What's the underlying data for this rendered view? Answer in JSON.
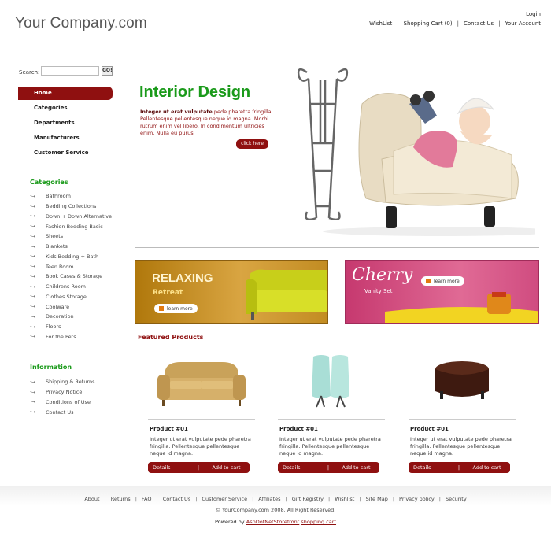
{
  "header": {
    "logo": "Your Company.com",
    "login": "Login",
    "nav": [
      "WishList",
      "Shopping Cart (0)",
      "Contact Us",
      "Your Account"
    ]
  },
  "search": {
    "label": "Search:",
    "value": "",
    "go": "GO!"
  },
  "sidebar": {
    "main_nav": [
      "Home",
      "Categories",
      "Departments",
      "Manufacturers",
      "Customer Service"
    ],
    "categories_title": "Categories",
    "categories": [
      "Bathroom",
      "Bedding Collections",
      "Down + Down Alternative",
      "Fashion Bedding Basic",
      "Sheets",
      "Blankets",
      "Kids Bedding + Bath",
      "Teen Room",
      "Book Cases & Storage",
      "Childrens Room",
      "Clothes Storage",
      "Coolware",
      "Decoration",
      "Floors",
      "For the Pets"
    ],
    "information_title": "Information",
    "information": [
      "Shipping & Returns",
      "Privacy Notice",
      "Conditions of Use",
      "Contact Us"
    ]
  },
  "hero": {
    "title": "Interior Design",
    "lead": "Integer ut erat vulputate",
    "text": " pede pharetra fringilla. Pellentesque pellentesque neque id magna. Morbi rutrum enim vel libero. In condimentum ultricies enim. Nulla eu purus.",
    "button": "click here"
  },
  "banners": [
    {
      "title": "RELAXING",
      "subtitle": "Retreat",
      "button": "learn more"
    },
    {
      "title": "Cherry",
      "subtitle": "Vanity Set",
      "button": "learn more"
    }
  ],
  "featured_title": "Featured Products",
  "products": [
    {
      "name": "Product #01",
      "desc": "Integer ut erat vulputate pede pharetra fringilla. Pellentesque pellentesque neque id magna.",
      "details": "Details",
      "sep": "|",
      "cart": "Add to cart"
    },
    {
      "name": "Product #01",
      "desc": "Integer ut erat vulputate pede pharetra fringilla. Pellentesque pellentesque neque id magna.",
      "details": "Details",
      "sep": "|",
      "cart": "Add to cart"
    },
    {
      "name": "Product #01",
      "desc": "Integer ut erat vulputate pede pharetra fringilla. Pellentesque pellentesque neque id magna.",
      "details": "Details",
      "sep": "|",
      "cart": "Add to cart"
    }
  ],
  "footer": {
    "links": [
      "About",
      "Returns",
      "FAQ",
      "Contact Us",
      "Customer Service",
      "Affiliates",
      "Gift Registry",
      "Wishlist",
      "Site Map",
      "Privacy policy",
      "Security"
    ],
    "copyright": "© YourCompany.com 2008. All Right Reserved.",
    "powered_prefix": "Powered by",
    "powered_link1": "AspDotNetStorefront",
    "powered_link2": "shopping cart"
  },
  "colors": {
    "brand_red": "#8f1010",
    "accent_green": "#1a9a1a"
  },
  "icons": {
    "list_arrow": "dotted-arrow-icon",
    "learn_more": "orange-square-icon"
  }
}
